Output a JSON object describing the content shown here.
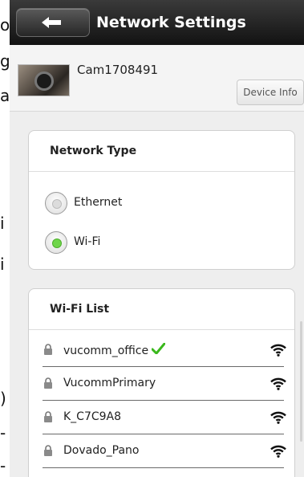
{
  "left_strip_fragments": [
    "o",
    "g",
    "a",
    "i",
    "i",
    ")",
    "-",
    "-"
  ],
  "header": {
    "back_icon": "back-arrow-icon",
    "title": "Network Settings"
  },
  "device": {
    "name": "Cam1708491",
    "info_button": "Device Info"
  },
  "network_type": {
    "heading": "Network Type",
    "options": [
      {
        "label": "Ethernet",
        "selected": false
      },
      {
        "label": "Wi-Fi",
        "selected": true
      }
    ],
    "accent_color": "#6fd64a"
  },
  "wifi_list": {
    "heading": "Wi-Fi List",
    "networks": [
      {
        "ssid": "vucomm_office",
        "locked": true,
        "connected": true
      },
      {
        "ssid": "VucommPrimary",
        "locked": true,
        "connected": false
      },
      {
        "ssid": "K_C7C9A8",
        "locked": true,
        "connected": false
      },
      {
        "ssid": "Dovado_Pano",
        "locked": true,
        "connected": false
      }
    ]
  }
}
